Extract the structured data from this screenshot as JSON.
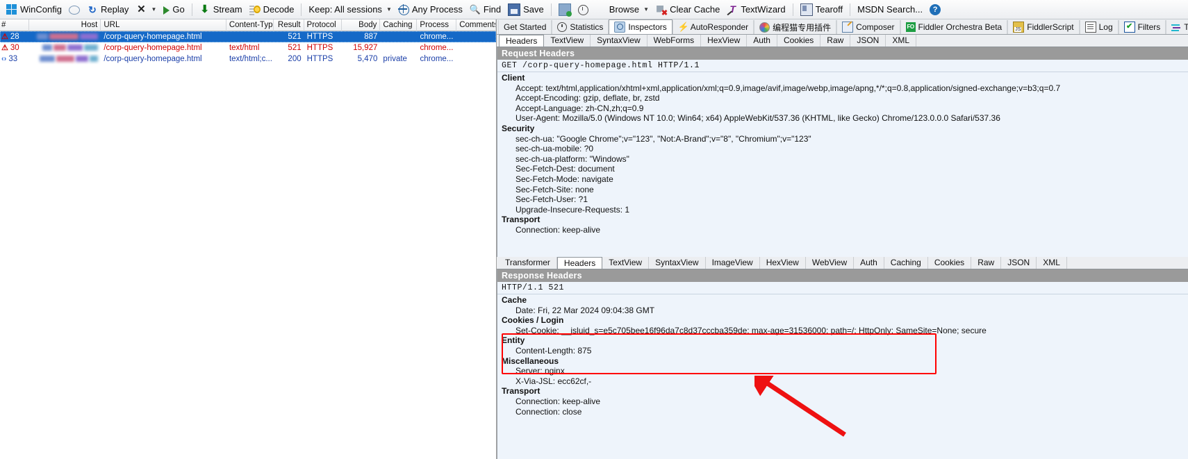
{
  "toolbar": {
    "items": [
      {
        "icon": "windows-logo-icon",
        "label": "WinConfig",
        "caret": false
      },
      {
        "icon": "comment-bubble-icon",
        "label": "",
        "caret": false
      },
      {
        "icon": "replay-icon",
        "label": "Replay",
        "caret": false
      },
      {
        "icon": "remove-x-icon",
        "label": "",
        "caret": true
      },
      {
        "icon": "play-go-icon",
        "label": "Go",
        "caret": false
      },
      {
        "icon": "sep",
        "label": "",
        "caret": false
      },
      {
        "icon": "stream-arrow-icon",
        "label": "Stream",
        "caret": false
      },
      {
        "icon": "decode-icon",
        "label": "Decode",
        "caret": false
      },
      {
        "icon": "sep",
        "label": "",
        "caret": false
      },
      {
        "icon": "none",
        "label": "Keep: All sessions",
        "caret": true
      },
      {
        "icon": "globe-icon",
        "label": "Any Process",
        "caret": false
      },
      {
        "icon": "binoculars-find-icon",
        "label": "Find",
        "caret": false
      },
      {
        "icon": "save-disk-icon",
        "label": "Save",
        "caret": false
      },
      {
        "icon": "sep",
        "label": "",
        "caret": false
      },
      {
        "icon": "clipboard-copy-icon",
        "label": "",
        "caret": false
      },
      {
        "icon": "timer-clock-icon",
        "label": "",
        "caret": false
      },
      {
        "icon": "internet-explorer-icon",
        "label": "Browse",
        "caret": true
      },
      {
        "icon": "clear-cache-icon",
        "label": "Clear Cache",
        "caret": false
      },
      {
        "icon": "textwizard-icon",
        "label": "TextWizard",
        "caret": false
      },
      {
        "icon": "sep",
        "label": "",
        "caret": false
      },
      {
        "icon": "tearoff-icon",
        "label": "Tearoff",
        "caret": false
      },
      {
        "icon": "sep",
        "label": "",
        "caret": false
      },
      {
        "icon": "none",
        "label": "MSDN Search...",
        "caret": false
      },
      {
        "icon": "help-icon",
        "label": "",
        "caret": false
      }
    ]
  },
  "grid": {
    "columns": [
      {
        "key": "num",
        "label": "#",
        "align": "left"
      },
      {
        "key": "host",
        "label": "Host",
        "align": "right"
      },
      {
        "key": "url",
        "label": "URL",
        "align": "left"
      },
      {
        "key": "content_type",
        "label": "Content-Type",
        "align": "left"
      },
      {
        "key": "result",
        "label": "Result",
        "align": "right"
      },
      {
        "key": "protocol",
        "label": "Protocol",
        "align": "left"
      },
      {
        "key": "body",
        "label": "Body",
        "align": "right"
      },
      {
        "key": "caching",
        "label": "Caching",
        "align": "left"
      },
      {
        "key": "process",
        "label": "Process",
        "align": "left"
      },
      {
        "key": "comments",
        "label": "Comments",
        "align": "left"
      }
    ],
    "rows": [
      {
        "icon": "warning-icon",
        "num": "28",
        "host": "www.████ov.cn",
        "url": "/corp-query-homepage.html",
        "content_type": "",
        "result": "521",
        "protocol": "HTTPS",
        "body": "887",
        "caching": "",
        "process": "chrome...",
        "comments": "",
        "state": "selected"
      },
      {
        "icon": "warning-icon",
        "num": "30",
        "host": "w██.████.██",
        "url": "/corp-query-homepage.html",
        "content_type": "text/html",
        "result": "521",
        "protocol": "HTTPS",
        "body": "15,927",
        "caching": "",
        "process": "chrome...",
        "comments": "",
        "state": "error"
      },
      {
        "icon": "angle-brackets-icon",
        "num": "33",
        "host": "w██.████.██n",
        "url": "/corp-query-homepage.html",
        "content_type": "text/html;c...",
        "result": "200",
        "protocol": "HTTPS",
        "body": "5,470",
        "caching": "private",
        "process": "chrome...",
        "comments": "",
        "state": "normal"
      }
    ]
  },
  "right_tabs": [
    {
      "icon": "none",
      "label": "Get Started",
      "active": false
    },
    {
      "icon": "clock-icon",
      "label": "Statistics",
      "active": false
    },
    {
      "icon": "inspectors-magnifier-icon",
      "label": "Inspectors",
      "active": true
    },
    {
      "icon": "lightning-bolt-icon",
      "label": "AutoResponder",
      "active": false
    },
    {
      "icon": "colorball-icon",
      "label": "编程猫专用插件",
      "active": false
    },
    {
      "icon": "composer-pencil-icon",
      "label": "Composer",
      "active": false
    },
    {
      "icon": "fiddler-orchestra-icon",
      "label": "Fiddler Orchestra Beta",
      "active": false
    },
    {
      "icon": "fiddlerscript-icon",
      "label": "FiddlerScript",
      "active": false
    },
    {
      "icon": "log-icon",
      "label": "Log",
      "active": false
    },
    {
      "icon": "filters-check-icon",
      "label": "Filters",
      "active": false
    },
    {
      "icon": "timeline-icon",
      "label": "Tim",
      "active": false
    }
  ],
  "request": {
    "subtabs": [
      {
        "label": "Headers",
        "active": true
      },
      {
        "label": "TextView",
        "active": false
      },
      {
        "label": "SyntaxView",
        "active": false
      },
      {
        "label": "WebForms",
        "active": false
      },
      {
        "label": "HexView",
        "active": false
      },
      {
        "label": "Auth",
        "active": false
      },
      {
        "label": "Cookies",
        "active": false
      },
      {
        "label": "Raw",
        "active": false
      },
      {
        "label": "JSON",
        "active": false
      },
      {
        "label": "XML",
        "active": false
      }
    ],
    "title": "Request Headers",
    "request_line": "GET /corp-query-homepage.html HTTP/1.1",
    "sections": [
      {
        "name": "Client",
        "lines": [
          "Accept: text/html,application/xhtml+xml,application/xml;q=0.9,image/avif,image/webp,image/apng,*/*;q=0.8,application/signed-exchange;v=b3;q=0.7",
          "Accept-Encoding: gzip, deflate, br, zstd",
          "Accept-Language: zh-CN,zh;q=0.9",
          "User-Agent: Mozilla/5.0 (Windows NT 10.0; Win64; x64) AppleWebKit/537.36 (KHTML, like Gecko) Chrome/123.0.0.0 Safari/537.36"
        ]
      },
      {
        "name": "Security",
        "lines": [
          "sec-ch-ua: \"Google Chrome\";v=\"123\", \"Not:A-Brand\";v=\"8\", \"Chromium\";v=\"123\"",
          "sec-ch-ua-mobile: ?0",
          "sec-ch-ua-platform: \"Windows\"",
          "Sec-Fetch-Dest: document",
          "Sec-Fetch-Mode: navigate",
          "Sec-Fetch-Site: none",
          "Sec-Fetch-User: ?1",
          "Upgrade-Insecure-Requests: 1"
        ]
      },
      {
        "name": "Transport",
        "lines": [
          "Connection: keep-alive"
        ]
      }
    ]
  },
  "response": {
    "subtabs": [
      {
        "label": "Transformer",
        "active": false
      },
      {
        "label": "Headers",
        "active": true
      },
      {
        "label": "TextView",
        "active": false
      },
      {
        "label": "SyntaxView",
        "active": false
      },
      {
        "label": "ImageView",
        "active": false
      },
      {
        "label": "HexView",
        "active": false
      },
      {
        "label": "WebView",
        "active": false
      },
      {
        "label": "Auth",
        "active": false
      },
      {
        "label": "Caching",
        "active": false
      },
      {
        "label": "Cookies",
        "active": false
      },
      {
        "label": "Raw",
        "active": false
      },
      {
        "label": "JSON",
        "active": false
      },
      {
        "label": "XML",
        "active": false
      }
    ],
    "title": "Response Headers",
    "status_line": "HTTP/1.1 521",
    "sections": [
      {
        "name": "Cache",
        "lines": [
          "Date: Fri, 22 Mar 2024 09:04:38 GMT"
        ]
      },
      {
        "name": "Cookies / Login",
        "lines": [
          "Set-Cookie: __jsluid_s=e5c705bee16f96da7c8d37cccba359de; max-age=31536000; path=/; HttpOnly; SameSite=None; secure"
        ]
      },
      {
        "name": "Entity",
        "lines": [
          "Content-Length: 875"
        ]
      },
      {
        "name": "Miscellaneous",
        "lines": [
          "Server: nginx",
          "X-Via-JSL: ecc62cf,-"
        ]
      },
      {
        "name": "Transport",
        "lines": [
          "Connection: keep-alive",
          "Connection: close"
        ]
      }
    ]
  },
  "annotations": {
    "highlight_color": "#ff0000",
    "arrow_color": "#ee1111"
  }
}
